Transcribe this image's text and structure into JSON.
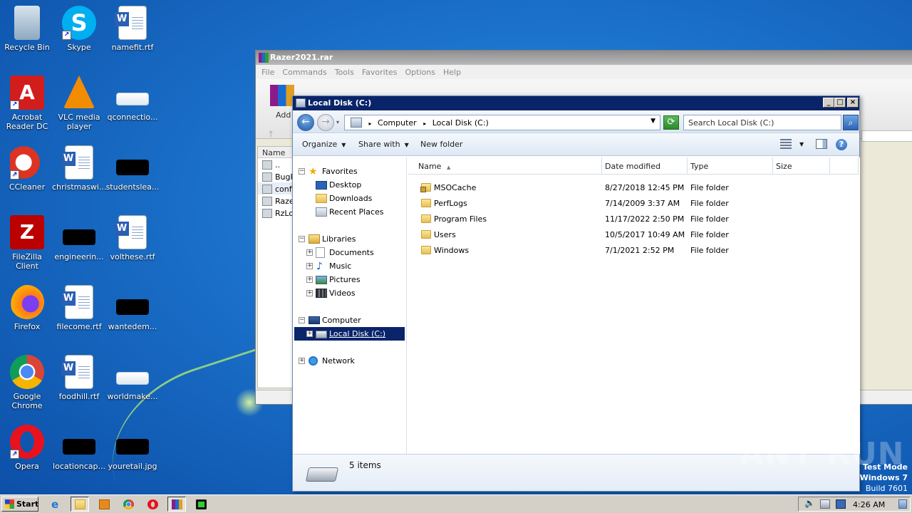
{
  "desktop": {
    "icons": [
      {
        "label": "Recycle Bin",
        "kind": "recycle-bin"
      },
      {
        "label": "Skype",
        "kind": "skype"
      },
      {
        "label": "namefit.rtf",
        "kind": "word-doc"
      },
      {
        "label": "Acrobat Reader DC",
        "kind": "acrobat"
      },
      {
        "label": "VLC media player",
        "kind": "vlc"
      },
      {
        "label": "qconnectio...",
        "kind": "file"
      },
      {
        "label": "CCleaner",
        "kind": "ccleaner"
      },
      {
        "label": "christmaswi...",
        "kind": "word-doc"
      },
      {
        "label": "studentslea...",
        "kind": "file"
      },
      {
        "label": "FileZilla Client",
        "kind": "filezilla"
      },
      {
        "label": "engineerin...",
        "kind": "file"
      },
      {
        "label": "volthese.rtf",
        "kind": "word-doc"
      },
      {
        "label": "Firefox",
        "kind": "firefox"
      },
      {
        "label": "filecome.rtf",
        "kind": "word-doc"
      },
      {
        "label": "wantedem...",
        "kind": "file"
      },
      {
        "label": "Google Chrome",
        "kind": "chrome"
      },
      {
        "label": "foodhill.rtf",
        "kind": "word-doc"
      },
      {
        "label": "worldmake...",
        "kind": "file"
      },
      {
        "label": "Opera",
        "kind": "opera"
      },
      {
        "label": "locationcap...",
        "kind": "file"
      },
      {
        "label": "youretail.jpg",
        "kind": "file"
      }
    ]
  },
  "winrar": {
    "title": "Razer2021.rar",
    "menu": [
      "File",
      "Commands",
      "Tools",
      "Favorites",
      "Options",
      "Help"
    ],
    "add_label": "Add",
    "list_header": "Name",
    "list_rows": [
      "..",
      "BugR",
      "confi",
      "Raze",
      "RzLo"
    ]
  },
  "explorer": {
    "title": "Local Disk (C:)",
    "address": {
      "crumbs": [
        "Computer",
        "Local Disk (C:)"
      ]
    },
    "search_placeholder": "Search Local Disk (C:)",
    "commands": {
      "organize": "Organize",
      "share_with": "Share with",
      "new_folder": "New folder"
    },
    "tree": {
      "favorites": "Favorites",
      "desktop": "Desktop",
      "downloads": "Downloads",
      "recent_places": "Recent Places",
      "libraries": "Libraries",
      "documents": "Documents",
      "music": "Music",
      "pictures": "Pictures",
      "videos": "Videos",
      "computer": "Computer",
      "local_disk": "Local Disk (C:)",
      "network": "Network"
    },
    "columns": {
      "name": "Name",
      "date": "Date modified",
      "type": "Type",
      "size": "Size"
    },
    "files": [
      {
        "name": "MSOCache",
        "date": "8/27/2018 12:45 PM",
        "type": "File folder",
        "locked": true
      },
      {
        "name": "PerfLogs",
        "date": "7/14/2009 3:37 AM",
        "type": "File folder",
        "locked": false
      },
      {
        "name": "Program Files",
        "date": "11/17/2022 2:50 PM",
        "type": "File folder",
        "locked": false
      },
      {
        "name": "Users",
        "date": "10/5/2017 10:49 AM",
        "type": "File folder",
        "locked": false
      },
      {
        "name": "Windows",
        "date": "7/1/2021 2:52 PM",
        "type": "File folder",
        "locked": false
      }
    ],
    "status": "5 items"
  },
  "watermark": "ANY RUN",
  "test_mode": {
    "line1": "Test Mode",
    "line2": "Windows 7",
    "line3": "Build 7601"
  },
  "taskbar": {
    "start_label": "Start",
    "clock": "4:26 AM"
  }
}
